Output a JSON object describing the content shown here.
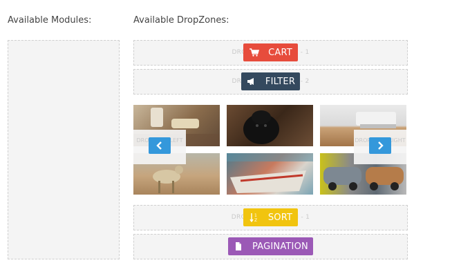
{
  "headings": {
    "modules": "Available Modules:",
    "dropzones": "Available DropZones:"
  },
  "zones": {
    "header1": "DROPZONE HEADER - 1",
    "header2": "DROPZONE HEADER - 2",
    "bottom1": "DROPZONE BOTTOM - 1",
    "left": "DROPZONE LEFT",
    "right": "DROPZONE RIGHT"
  },
  "modules": {
    "cart": {
      "label": "CART",
      "icon": "cart-icon",
      "color": "#e74c3c"
    },
    "filter": {
      "label": "FILTER",
      "icon": "bullhorn-icon",
      "color": "#34495e"
    },
    "sort": {
      "label": "SORT",
      "icon": "sort-icon",
      "color": "#f1c40f"
    },
    "pagination": {
      "label": "PAGINATION",
      "icon": "file-icon",
      "color": "#9b59b6"
    }
  },
  "slider": {
    "prev_icon": "chevron-left-icon",
    "next_icon": "chevron-right-icon",
    "accent": "#3498db"
  },
  "images": [
    "coffee-cup-photo",
    "black-dog-photo",
    "desk-laptop-photo",
    "cheetah-photo",
    "boats-photo",
    "vintage-cars-photo"
  ]
}
